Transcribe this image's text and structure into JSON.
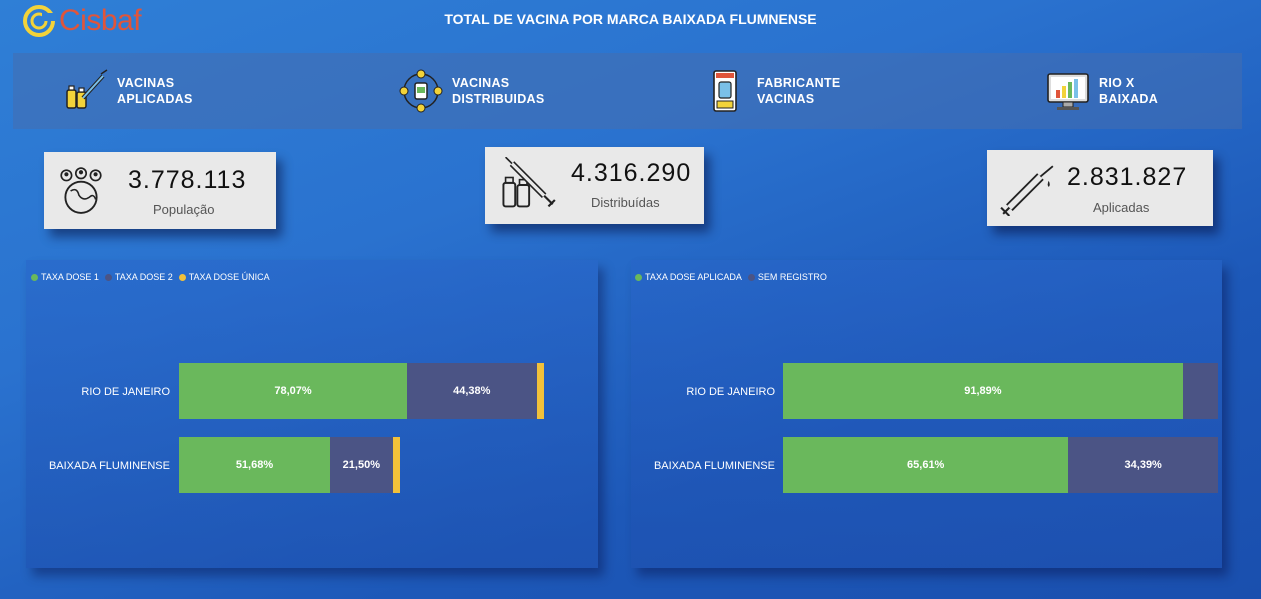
{
  "header": {
    "logo_text": "Cisbaf",
    "title": "TOTAL DE VACINA POR MARCA BAIXADA FLUMNENSE"
  },
  "nav": [
    {
      "label": "VACINAS\nAPLICADAS",
      "icon": "vaccine-bottles-icon"
    },
    {
      "label": "VACINAS\nDISTRIBUIDAS",
      "icon": "vaccine-distribution-icon"
    },
    {
      "label": "FABRICANTE\nVACINAS",
      "icon": "vaccine-vial-icon"
    },
    {
      "label": "RIO X\nBAIXADA",
      "icon": "chart-monitor-icon"
    }
  ],
  "cards": {
    "populacao": {
      "value": "3.778.113",
      "label": "População"
    },
    "distribuidas": {
      "value": "4.316.290",
      "label": "Distribuídas"
    },
    "aplicadas": {
      "value": "2.831.827",
      "label": "Aplicadas"
    }
  },
  "colors": {
    "green": "#6ab85c",
    "navy": "#4b5485",
    "yellow": "#f2c13a"
  },
  "chart_data": [
    {
      "type": "bar",
      "orientation": "horizontal",
      "stacked": true,
      "categories": [
        "RIO DE JANEIRO",
        "BAIXADA FLUMINENSE"
      ],
      "series": [
        {
          "name": "TAXA DOSE 1",
          "values": [
            78.07,
            51.68
          ],
          "labels": [
            "78,07%",
            "51,68%"
          ],
          "color": "#6ab85c"
        },
        {
          "name": "TAXA DOSE 2",
          "values": [
            44.38,
            21.5
          ],
          "labels": [
            "44,38%",
            "21,50%"
          ],
          "color": "#4b5485"
        },
        {
          "name": "TAXA DOSE ÚNICA",
          "values": [
            2.4,
            2.4
          ],
          "labels": [
            "",
            ""
          ],
          "color": "#f2c13a"
        }
      ],
      "xlim": [
        0,
        126
      ],
      "legend_position": "top-left"
    },
    {
      "type": "bar",
      "orientation": "horizontal",
      "stacked": true,
      "categories": [
        "RIO DE JANEIRO",
        "BAIXADA FLUMINENSE"
      ],
      "series": [
        {
          "name": "TAXA DOSE APLICADA",
          "values": [
            91.89,
            65.61
          ],
          "labels": [
            "91,89%",
            "65,61%"
          ],
          "color": "#6ab85c"
        },
        {
          "name": "SEM REGISTRO",
          "values": [
            8.11,
            34.39
          ],
          "labels": [
            "",
            "34,39%"
          ],
          "color": "#4b5485"
        }
      ],
      "xlim": [
        0,
        100
      ],
      "legend_position": "top-left"
    }
  ]
}
